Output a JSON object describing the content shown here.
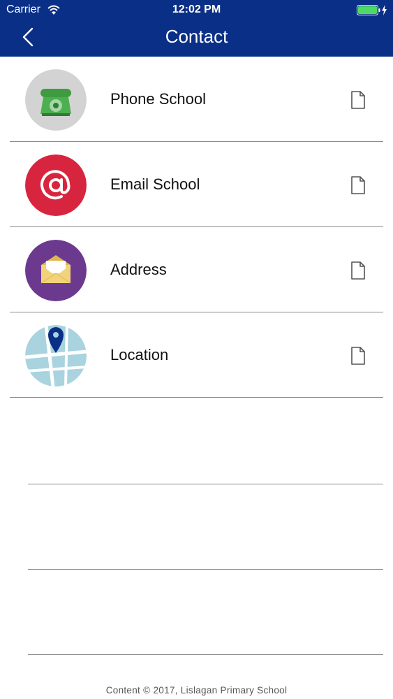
{
  "status_bar": {
    "carrier": "Carrier",
    "time": "12:02 PM"
  },
  "nav": {
    "title": "Contact",
    "back_icon": "chevron-left-icon"
  },
  "items": [
    {
      "label": "Phone School",
      "icon": "telephone-icon",
      "icon_bg": "#d3d3d3"
    },
    {
      "label": "Email School",
      "icon": "at-sign-icon",
      "icon_bg": "#d8253f"
    },
    {
      "label": "Address",
      "icon": "envelope-icon",
      "icon_bg": "#6b3a8f"
    },
    {
      "label": "Location",
      "icon": "map-pin-icon",
      "icon_bg": "#a9d3de"
    }
  ],
  "footer": {
    "text": "Content © 2017, Lislagan Primary School"
  },
  "colors": {
    "header_bg": "#0a2f86",
    "separator": "#8c8c8c"
  }
}
